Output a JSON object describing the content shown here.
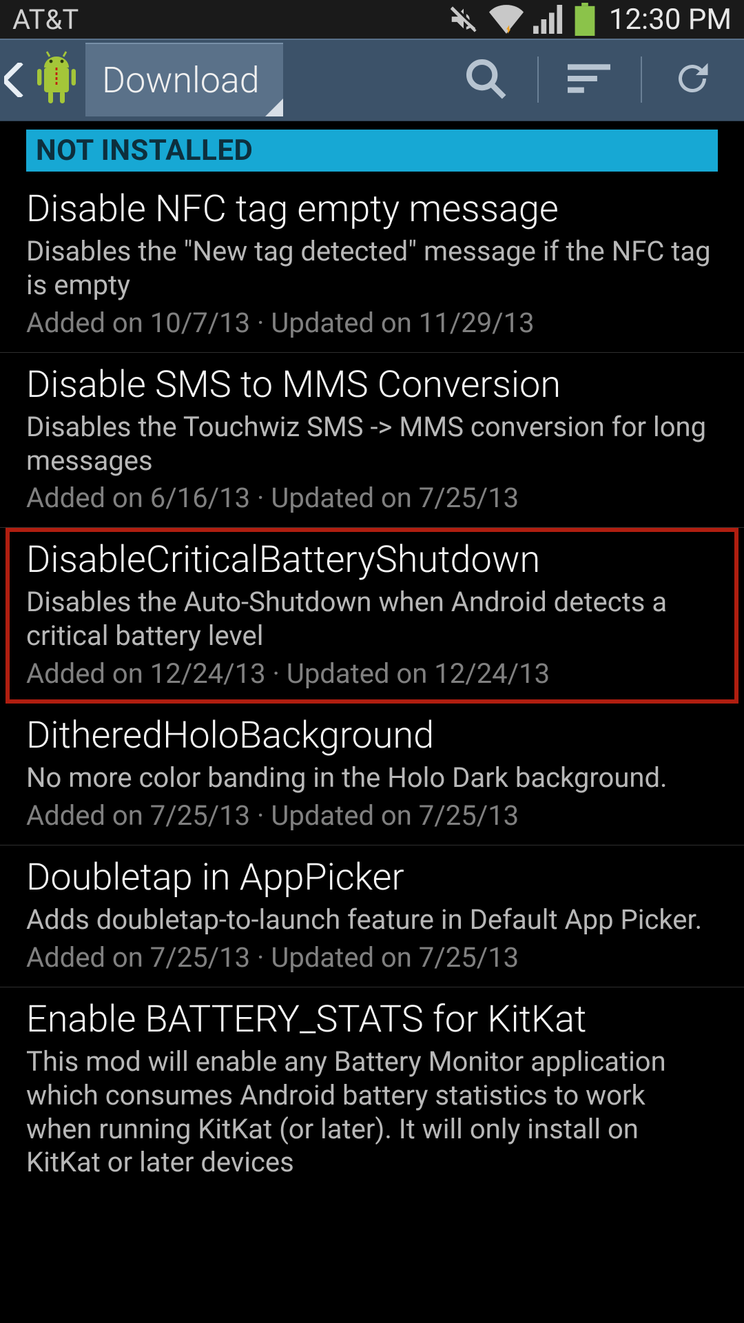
{
  "status_bar": {
    "carrier": "AT&T",
    "clock": "12:30 PM"
  },
  "action_bar": {
    "tab_label": "Download"
  },
  "section_header": "NOT INSTALLED",
  "modules": [
    {
      "title": "Disable NFC tag empty message",
      "desc": "Disables the \"New tag detected\" message if the NFC tag is empty",
      "meta": "Added on 10/7/13 · Updated on 11/29/13",
      "highlighted": false
    },
    {
      "title": "Disable SMS to MMS Conversion",
      "desc": "Disables the Touchwiz SMS -> MMS conversion for long messages",
      "meta": "Added on 6/16/13 · Updated on 7/25/13",
      "highlighted": false
    },
    {
      "title": "DisableCriticalBatteryShutdown",
      "desc": "Disables the Auto-Shutdown when Android detects a critical battery level",
      "meta": "Added on 12/24/13 · Updated on 12/24/13",
      "highlighted": true
    },
    {
      "title": "DitheredHoloBackground",
      "desc": "No more color banding in the Holo Dark background.",
      "meta": "Added on 7/25/13 · Updated on 7/25/13",
      "highlighted": false
    },
    {
      "title": "Doubletap in AppPicker",
      "desc": "Adds doubletap-to-launch feature in Default App Picker.",
      "meta": "Added on 7/25/13 · Updated on 7/25/13",
      "highlighted": false
    },
    {
      "title": "Enable BATTERY_STATS for KitKat",
      "desc": "This mod will enable any Battery Monitor application which consumes Android battery statistics to work when running KitKat (or later). It will only install on KitKat or later devices",
      "meta": "",
      "highlighted": false
    }
  ]
}
